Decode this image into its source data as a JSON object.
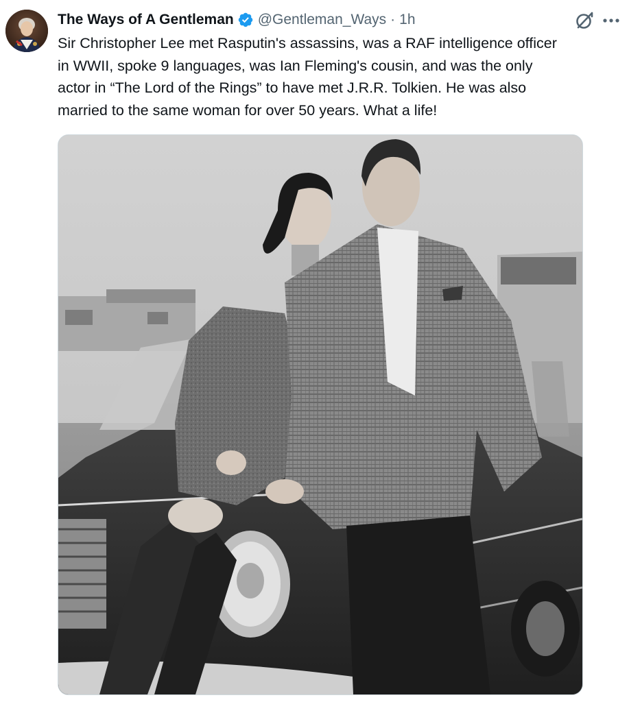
{
  "post": {
    "author": {
      "display_name": "The Ways of A Gentleman",
      "handle": "@Gentleman_Ways",
      "verified": true,
      "avatar_icon": "portrait-avatar-icon"
    },
    "separator": "·",
    "time": "1h",
    "text": "Sir Christopher Lee met Rasputin's assassins, was a RAF intelligence officer\nin WWII, spoke 9 languages, was Ian Fleming's cousin, and was the only\nactor in “The Lord of the Rings” to have met J.R.R. Tolkien. He was also\nmarried to the same woman for over 50 years. What a life!",
    "actions": {
      "grok_icon": "grok-icon",
      "more_icon": "more-options-icon"
    },
    "media": {
      "type": "photo",
      "style": "black-and-white"
    }
  },
  "colors": {
    "text_primary": "#0f1419",
    "text_secondary": "#536471",
    "verified_blue": "#1d9bf0",
    "media_border": "#cfd9de"
  }
}
